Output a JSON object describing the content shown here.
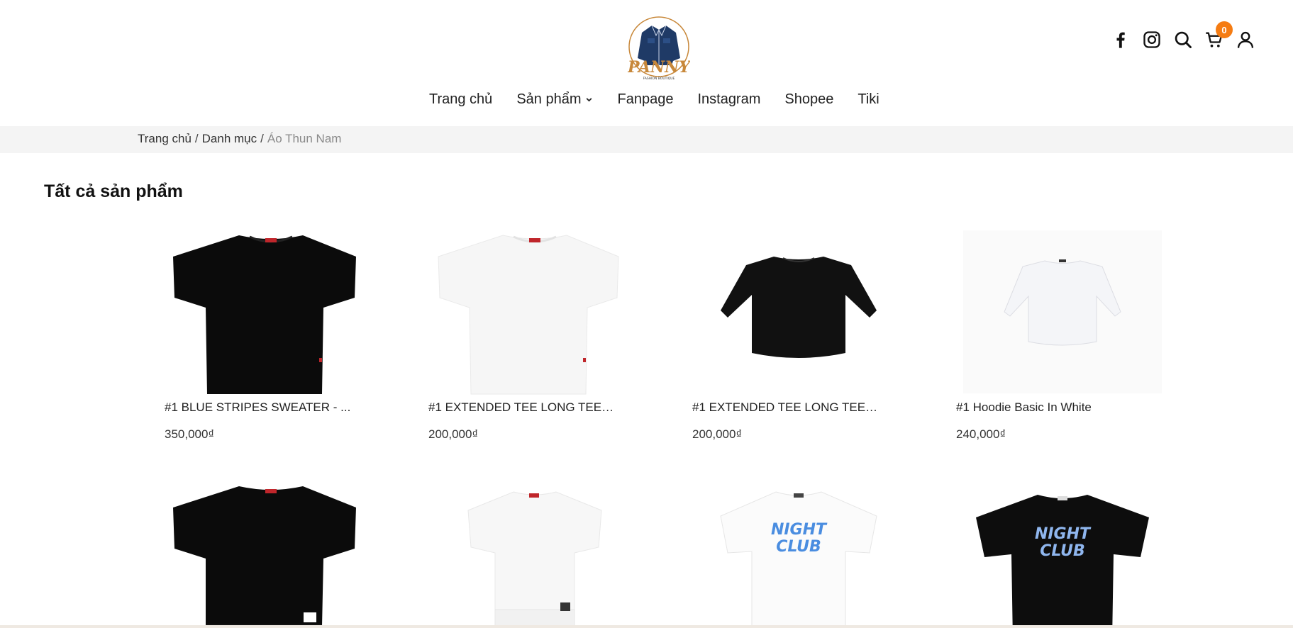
{
  "brand": {
    "logo_name": "PANNY",
    "logo_tagline": "FASHION BOUTIQUE"
  },
  "nav": {
    "items": [
      {
        "label": "Trang chủ"
      },
      {
        "label": "Sản phẩm"
      },
      {
        "label": "Fanpage"
      },
      {
        "label": "Instagram"
      },
      {
        "label": "Shopee"
      },
      {
        "label": "Tiki"
      }
    ]
  },
  "header_icons": {
    "facebook": "facebook-icon",
    "instagram": "instagram-icon",
    "search": "search-icon",
    "cart": "cart-icon",
    "account": "user-icon",
    "cart_count": "0"
  },
  "breadcrumb": {
    "home": "Trang chủ",
    "category": "Danh mục",
    "current": "Áo Thun Nam"
  },
  "section_title": "Tất cả sản phẩm",
  "colors": {
    "accent": "#f57c12",
    "breadcrumb_bg": "#f4f4f4",
    "logo_navy": "#1f3a66",
    "logo_gold": "#c8883a"
  },
  "products": [
    {
      "name": "#1 BLUE STRIPES SWEATER - ...",
      "price": "350,000₫"
    },
    {
      "name": "#1 EXTENDED TEE LONG TEE -...",
      "price": "200,000₫"
    },
    {
      "name": "#1 EXTENDED TEE LONG TEE -...",
      "price": "200,000₫"
    },
    {
      "name": "#1 Hoodie Basic In White",
      "price": "240,000₫"
    },
    {
      "name": "",
      "price": ""
    },
    {
      "name": "",
      "price": ""
    },
    {
      "name": "NIGHT CLUB",
      "price": ""
    },
    {
      "name": "NIGHT CLUB",
      "price": ""
    }
  ],
  "product_print_text": {
    "p7_line1": "NIGHT",
    "p7_line2": "CLUB",
    "p8_line1": "NIGHT",
    "p8_line2": "CLUB"
  }
}
